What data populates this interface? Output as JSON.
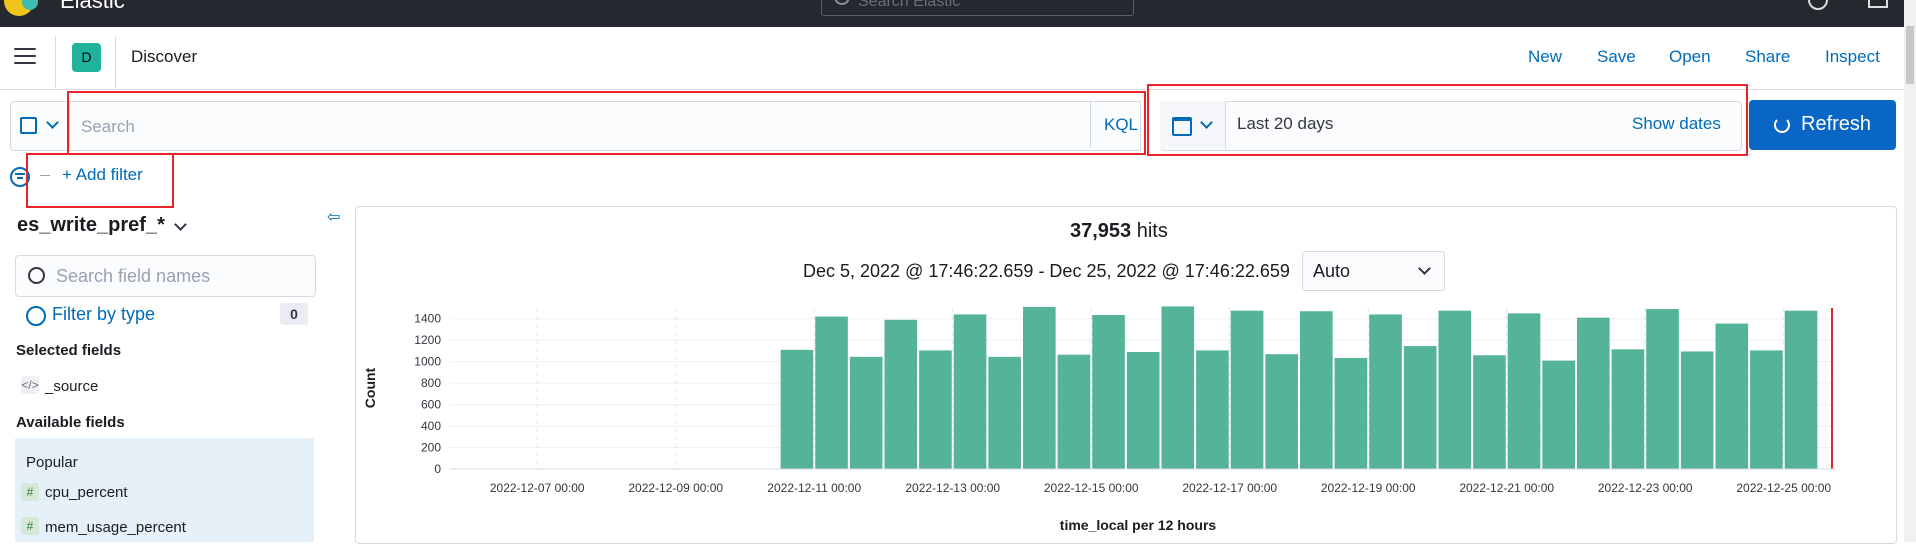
{
  "topbar": {
    "brand": "Elastic",
    "search_placeholder": "Search Elastic"
  },
  "header": {
    "avatar_letter": "D",
    "app_title": "Discover",
    "links": [
      "New",
      "Save",
      "Open",
      "Share",
      "Inspect"
    ]
  },
  "query": {
    "placeholder": "Search",
    "language": "KQL"
  },
  "date": {
    "range_label": "Last 20 days",
    "show_dates": "Show dates",
    "refresh_label": "Refresh"
  },
  "filter": {
    "add_label": "+ Add filter"
  },
  "sidebar": {
    "index_pattern": "es_write_pref_*",
    "field_search_placeholder": "Search field names",
    "filter_by_type": "Filter by type",
    "filter_count": "0",
    "selected_heading": "Selected fields",
    "selected_fields": [
      {
        "type": "</>",
        "name": "_source"
      }
    ],
    "available_heading": "Available fields",
    "popular_heading": "Popular",
    "popular_fields": [
      {
        "type": "#",
        "name": "cpu_percent"
      },
      {
        "type": "#",
        "name": "mem_usage_percent"
      }
    ]
  },
  "results": {
    "hits_count": "37,953",
    "hits_label": " hits",
    "date_range": "Dec 5, 2022 @ 17:46:22.659 - Dec 25, 2022 @ 17:46:22.659",
    "interval": "Auto"
  },
  "colors": {
    "bar": "#54b399",
    "accent": "#006bb8",
    "refresh_bg": "#0966c4",
    "highlight": "#e7242b"
  },
  "chart_data": {
    "type": "bar",
    "ylabel": "Count",
    "xlabel": "time_local per 12 hours",
    "ylim": [
      0,
      1500
    ],
    "yticks": [
      0,
      200,
      400,
      600,
      800,
      1000,
      1200,
      1400
    ],
    "xticks": [
      "2022-12-07 00:00",
      "2022-12-09 00:00",
      "2022-12-11 00:00",
      "2022-12-13 00:00",
      "2022-12-15 00:00",
      "2022-12-17 00:00",
      "2022-12-19 00:00",
      "2022-12-21 00:00",
      "2022-12-23 00:00",
      "2022-12-25 00:00"
    ],
    "bar_start": "2022-12-10 12:00",
    "values": [
      1110,
      1420,
      1045,
      1390,
      1105,
      1440,
      1045,
      1510,
      1065,
      1435,
      1090,
      1515,
      1105,
      1475,
      1070,
      1470,
      1035,
      1440,
      1145,
      1475,
      1060,
      1450,
      1010,
      1410,
      1115,
      1490,
      1095,
      1355,
      1105,
      1475
    ]
  }
}
